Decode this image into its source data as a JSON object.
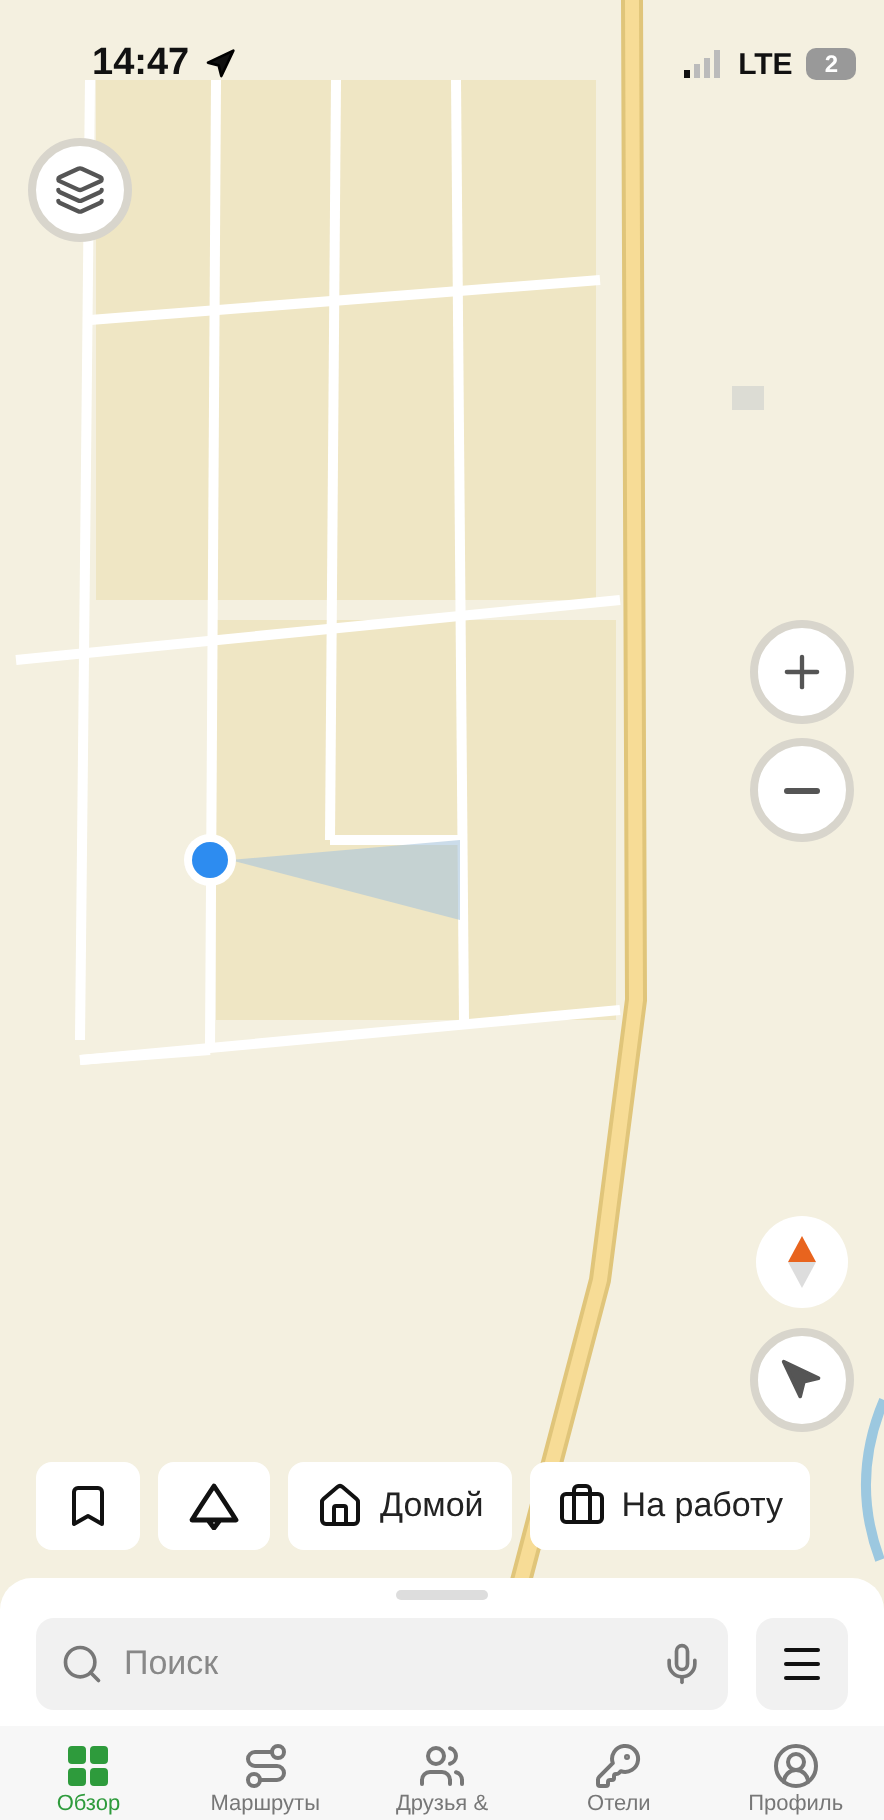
{
  "status_bar": {
    "time": "14:47",
    "network": "LTE",
    "sim_badge": "2"
  },
  "shortcuts": [
    {
      "label": "Домой"
    },
    {
      "label": "На работу"
    }
  ],
  "search": {
    "placeholder": "Поиск"
  },
  "tabs": [
    {
      "label": "Обзор",
      "selected": true
    },
    {
      "label": "Маршруты",
      "selected": false
    },
    {
      "label": "Друзья &",
      "selected": false
    },
    {
      "label": "Отели",
      "selected": false
    },
    {
      "label": "Профиль",
      "selected": false
    }
  ]
}
